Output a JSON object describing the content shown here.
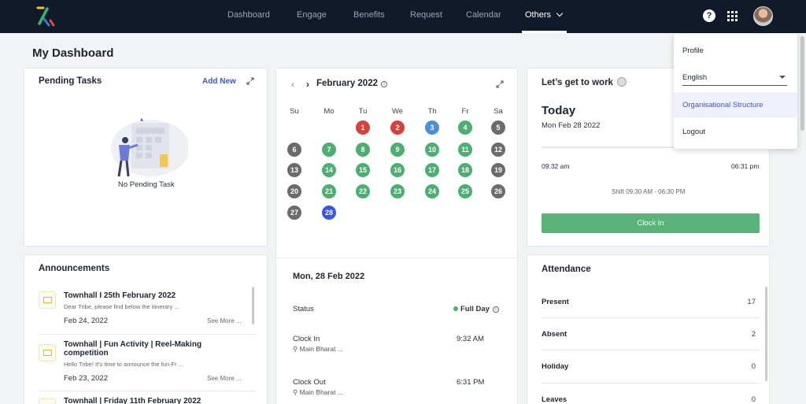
{
  "nav": {
    "items": [
      "Dashboard",
      "Engage",
      "Benefits",
      "Request",
      "Calendar"
    ],
    "others_label": "Others",
    "help": "?"
  },
  "page": {
    "title": "My Dashboard"
  },
  "pending_tasks": {
    "title": "Pending Tasks",
    "add_new": "Add New",
    "empty": "No Pending Task"
  },
  "calendar": {
    "month": "February 2022",
    "weekdays": [
      "Su",
      "Mo",
      "Tu",
      "We",
      "Th",
      "Fr",
      "Sa"
    ],
    "days": [
      {
        "d": "1",
        "c": "#d9403a"
      },
      {
        "d": "2",
        "c": "#d9403a"
      },
      {
        "d": "3",
        "c": "#4b90d9"
      },
      {
        "d": "4",
        "c": "#4caf72"
      },
      {
        "d": "5",
        "c": "#6b6b6b"
      },
      {
        "d": "6",
        "c": "#6b6b6b"
      },
      {
        "d": "7",
        "c": "#4caf72"
      },
      {
        "d": "8",
        "c": "#4caf72"
      },
      {
        "d": "9",
        "c": "#4caf72"
      },
      {
        "d": "10",
        "c": "#4caf72"
      },
      {
        "d": "11",
        "c": "#4caf72"
      },
      {
        "d": "12",
        "c": "#6b6b6b"
      },
      {
        "d": "13",
        "c": "#6b6b6b"
      },
      {
        "d": "14",
        "c": "#4caf72"
      },
      {
        "d": "15",
        "c": "#4caf72"
      },
      {
        "d": "16",
        "c": "#4caf72"
      },
      {
        "d": "17",
        "c": "#4caf72"
      },
      {
        "d": "18",
        "c": "#4caf72"
      },
      {
        "d": "19",
        "c": "#6b6b6b"
      },
      {
        "d": "20",
        "c": "#6b6b6b"
      },
      {
        "d": "21",
        "c": "#4caf72"
      },
      {
        "d": "22",
        "c": "#4caf72"
      },
      {
        "d": "23",
        "c": "#4caf72"
      },
      {
        "d": "24",
        "c": "#4caf72"
      },
      {
        "d": "25",
        "c": "#4caf72"
      },
      {
        "d": "26",
        "c": "#6b6b6b"
      },
      {
        "d": "27",
        "c": "#6b6b6b"
      },
      {
        "d": "28",
        "c": "#3a55e6"
      }
    ]
  },
  "day_detail": {
    "date": "Mon, 28 Feb 2022",
    "status_label": "Status",
    "status_value": "Full Day",
    "clock_in_label": "Clock In",
    "clock_in_time": "9:32 AM",
    "clock_in_loc": "Main Bharat ...",
    "clock_out_label": "Clock Out",
    "clock_out_time": "6:31 PM",
    "clock_out_loc": "Main Bharat ..."
  },
  "work": {
    "title": "Let’s get to work",
    "today": "Today",
    "date": "Mon Feb 28 2022",
    "start": "09:32 am",
    "end": "06:31 pm",
    "shift": "Shift 09:30 AM - 06:30 PM",
    "button": "Clock In"
  },
  "announcements": {
    "title": "Announcements",
    "items": [
      {
        "title": "Townhall I 25th February 2022",
        "snippet": "Dear Tribe, please find below the itinerary ...",
        "date": "Feb 24, 2022",
        "more": "See More ..."
      },
      {
        "title": "Townhall | Fun Activity | Reel-Making competition",
        "snippet": "Hello Tribe! It's time to announce the fun-Fr ...",
        "date": "Feb 23, 2022",
        "more": "See More ..."
      },
      {
        "title": "Townhall | Friday 11th February 2022",
        "snippet": "",
        "date": "",
        "more": ""
      }
    ]
  },
  "attendance": {
    "title": "Attendance",
    "rows": [
      {
        "label": "Present",
        "value": "17"
      },
      {
        "label": "Absent",
        "value": "2"
      },
      {
        "label": "Holiday",
        "value": "0"
      },
      {
        "label": "Leaves",
        "value": "0"
      }
    ]
  },
  "menu": {
    "profile": "Profile",
    "language": "English",
    "org": "Organisational Structure",
    "logout": "Logout"
  },
  "colors": {
    "nav_bg": "#111a2b",
    "accent": "#3a55d6",
    "clock_in": "#59b37a"
  }
}
